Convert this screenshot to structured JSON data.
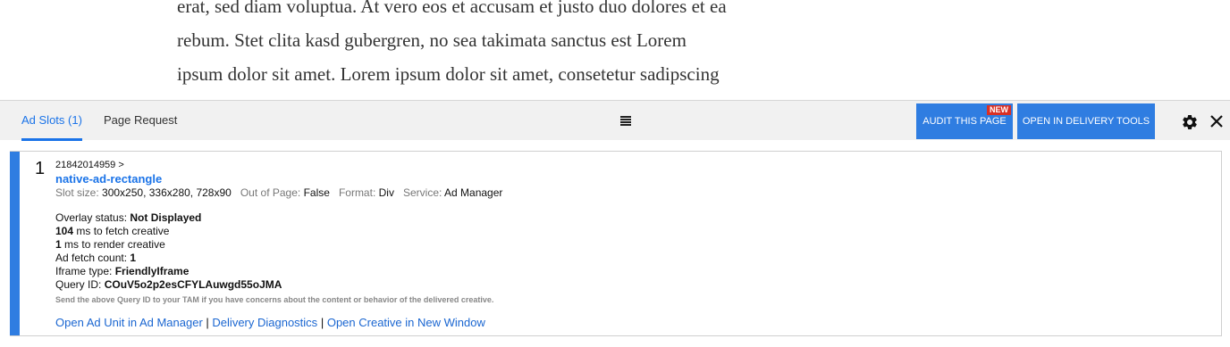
{
  "article": {
    "line1": "erat, sed diam voluptua. At vero eos et accusam et justo duo dolores et ea",
    "line2": "rebum. Stet clita kasd gubergren, no sea takimata sanctus est Lorem",
    "line3": "ipsum dolor sit amet. Lorem ipsum dolor sit amet, consetetur sadipscing"
  },
  "toolbar": {
    "tabs": [
      {
        "label": "Ad Slots (1)",
        "active": true
      },
      {
        "label": "Page Request",
        "active": false
      }
    ],
    "audit_label": "AUDIT THIS PAGE",
    "new_badge": "NEW",
    "delivery_label": "OPEN IN DELIVERY TOOLS",
    "accent_color": "#2f7de1"
  },
  "slot": {
    "number": "1",
    "path": "21842014959 >",
    "name": "native-ad-rectangle",
    "size_label": "Slot size:",
    "size_value": "300x250, 336x280, 728x90",
    "oop_label": "Out of Page:",
    "oop_value": "False",
    "format_label": "Format:",
    "format_value": "Div",
    "service_label": "Service:",
    "service_value": "Ad Manager",
    "overlay_label": "Overlay status:",
    "overlay_value": "Not Displayed",
    "fetch_value": "104",
    "fetch_label": "ms to fetch creative",
    "render_value": "1",
    "render_label": "ms to render creative",
    "count_label": "Ad fetch count:",
    "count_value": "1",
    "iframe_label": "Iframe type:",
    "iframe_value": "FriendlyIframe",
    "query_label": "Query ID:",
    "query_value": "COuV5o2p2esCFYLAuwgd55oJMA",
    "note": "Send the above Query ID to your TAM if you have concerns about the content or behavior of the delivered creative.",
    "links": {
      "ad_unit": "Open Ad Unit in Ad Manager",
      "sep": "|",
      "diagnostics": "Delivery Diagnostics",
      "creative": "Open Creative in New Window"
    }
  }
}
